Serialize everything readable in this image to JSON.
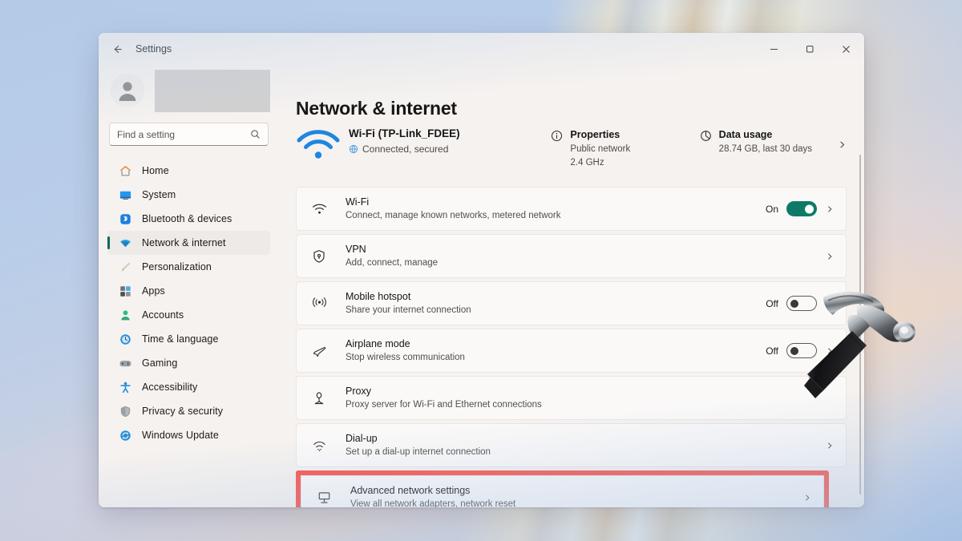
{
  "window": {
    "title": "Settings",
    "back_icon": "back-arrow-icon",
    "minimize": "−",
    "maximize": "❐",
    "close": "✕"
  },
  "sidebar": {
    "account_name_redacted": "",
    "search": {
      "placeholder": "Find a setting",
      "value": "",
      "icon": "search-icon"
    },
    "items": [
      {
        "label": "Home",
        "icon": "home-icon",
        "selected": false
      },
      {
        "label": "System",
        "icon": "system-icon",
        "selected": false
      },
      {
        "label": "Bluetooth & devices",
        "icon": "bluetooth-icon",
        "selected": false
      },
      {
        "label": "Network & internet",
        "icon": "network-icon",
        "selected": true
      },
      {
        "label": "Personalization",
        "icon": "brush-icon",
        "selected": false
      },
      {
        "label": "Apps",
        "icon": "apps-icon",
        "selected": false
      },
      {
        "label": "Accounts",
        "icon": "accounts-icon",
        "selected": false
      },
      {
        "label": "Time & language",
        "icon": "clock-icon",
        "selected": false
      },
      {
        "label": "Gaming",
        "icon": "gamepad-icon",
        "selected": false
      },
      {
        "label": "Accessibility",
        "icon": "accessibility-icon",
        "selected": false
      },
      {
        "label": "Privacy & security",
        "icon": "shield-icon",
        "selected": false
      },
      {
        "label": "Windows Update",
        "icon": "update-icon",
        "selected": false
      }
    ]
  },
  "main": {
    "page_title": "Network & internet",
    "connection": {
      "icon": "wifi-signal-icon",
      "name": "Wi-Fi (TP-Link_FDEE)",
      "status_icon": "globe-icon",
      "status": "Connected, secured"
    },
    "properties": {
      "icon": "info-icon",
      "title": "Properties",
      "line1": "Public network",
      "line2": "2.4 GHz"
    },
    "data_usage": {
      "icon": "pie-chart-icon",
      "title": "Data usage",
      "line1": "28.74 GB, last 30 days",
      "chevron": "chevron-right-icon"
    },
    "rows": [
      {
        "icon": "wifi-icon",
        "title": "Wi-Fi",
        "subtitle": "Connect, manage known networks, metered network",
        "toggle": {
          "state": "on",
          "label": "On"
        },
        "chevron": true,
        "highlighted": false
      },
      {
        "icon": "vpn-shield-icon",
        "title": "VPN",
        "subtitle": "Add, connect, manage",
        "toggle": null,
        "chevron": true,
        "highlighted": false
      },
      {
        "icon": "mobile-hotspot-icon",
        "title": "Mobile hotspot",
        "subtitle": "Share your internet connection",
        "toggle": {
          "state": "off",
          "label": "Off"
        },
        "chevron": true,
        "highlighted": false
      },
      {
        "icon": "airplane-icon",
        "title": "Airplane mode",
        "subtitle": "Stop wireless communication",
        "toggle": {
          "state": "off",
          "label": "Off"
        },
        "chevron": true,
        "highlighted": false
      },
      {
        "icon": "proxy-icon",
        "title": "Proxy",
        "subtitle": "Proxy server for Wi-Fi and Ethernet connections",
        "toggle": null,
        "chevron": false,
        "highlighted": false
      },
      {
        "icon": "dial-up-icon",
        "title": "Dial-up",
        "subtitle": "Set up a dial-up internet connection",
        "toggle": null,
        "chevron": true,
        "highlighted": false
      },
      {
        "icon": "advanced-network-icon",
        "title": "Advanced network settings",
        "subtitle": "View all network adapters, network reset",
        "toggle": null,
        "chevron": true,
        "highlighted": true
      }
    ]
  },
  "overlay": {
    "hammer_icon": "hammer-icon"
  },
  "colors": {
    "accent_green": "#0d7a68",
    "highlight_red": "#f8564e",
    "wifi_blue": "#1e86e0",
    "window_bg": "#f6f2ef",
    "row_bg": "#fbf9f8"
  }
}
